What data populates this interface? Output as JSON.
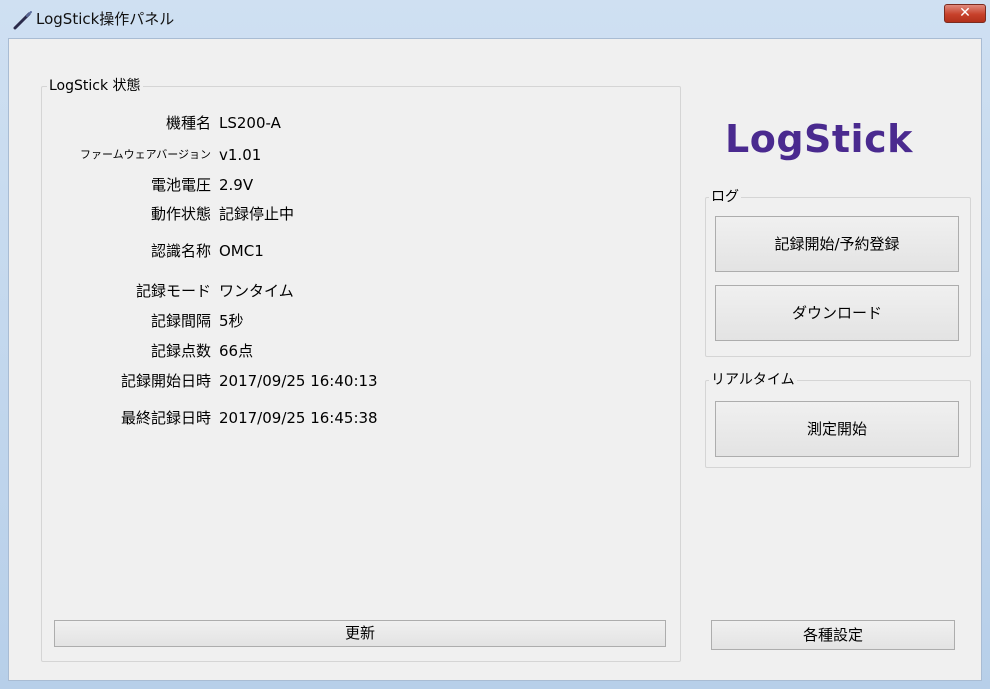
{
  "window": {
    "title": "LogStick操作パネル",
    "close_label": "✕"
  },
  "status_group": {
    "legend": "LogStick 状態",
    "rows": [
      {
        "label": "機種名",
        "value": "LS200-A"
      },
      {
        "label": "ファームウェアバージョン",
        "value": "v1.01"
      },
      {
        "label": "電池電圧",
        "value": "2.9V"
      },
      {
        "label": "動作状態",
        "value": "記録停止中"
      },
      {
        "label": "認識名称",
        "value": "OMC1"
      },
      {
        "label": "記録モード",
        "value": "ワンタイム"
      },
      {
        "label": "記録間隔",
        "value": "5秒"
      },
      {
        "label": "記録点数",
        "value": "66点"
      },
      {
        "label": "記録開始日時",
        "value": "2017/09/25 16:40:13"
      },
      {
        "label": "最終記録日時",
        "value": "2017/09/25 16:45:38"
      }
    ],
    "refresh_label": "更新"
  },
  "logo_text": "LogStick",
  "log_group": {
    "legend": "ログ",
    "start_label": "記録開始/予約登録",
    "download_label": "ダウンロード"
  },
  "realtime_group": {
    "legend": "リアルタイム",
    "measure_label": "測定開始"
  },
  "settings_label": "各種設定",
  "colors": {
    "logo": "#4a2a8f",
    "close_button": "#c7412b",
    "panel_bg": "#f0f0f0"
  }
}
